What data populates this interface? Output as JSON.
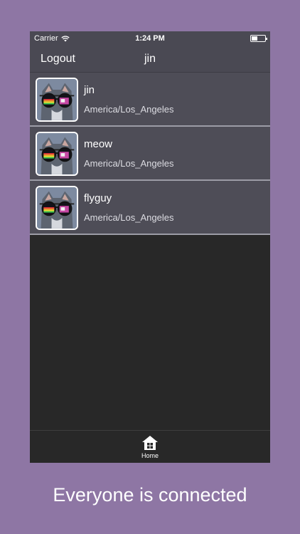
{
  "status_bar": {
    "carrier": "Carrier",
    "time": "1:24 PM",
    "icons": [
      "wifi-icon",
      "battery-icon"
    ]
  },
  "nav": {
    "logout_label": "Logout",
    "title": "jin"
  },
  "users": [
    {
      "name": "jin",
      "timezone": "America/Los_Angeles",
      "avatar": "cat-with-sunglasses"
    },
    {
      "name": "meow",
      "timezone": "America/Los_Angeles",
      "avatar": "cat-with-sunglasses"
    },
    {
      "name": "flyguy",
      "timezone": "America/Los_Angeles",
      "avatar": "cat-with-sunglasses"
    }
  ],
  "tab_bar": {
    "home_label": "Home",
    "home_icon": "home-icon"
  },
  "caption": "Everyone is connected",
  "colors": {
    "background": "#8e76a4",
    "nav_bar": "#4a4953",
    "row_background": "#4e4d57",
    "list_background": "#282828"
  }
}
